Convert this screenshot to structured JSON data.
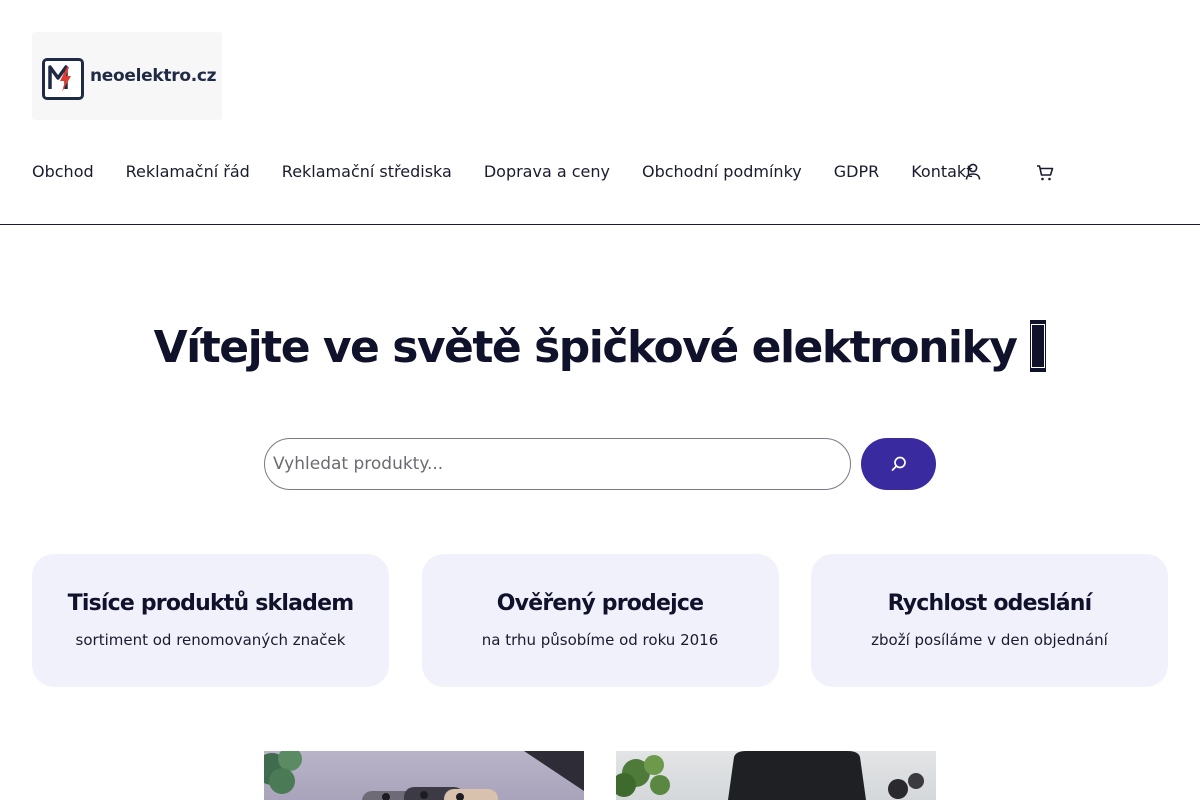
{
  "header": {
    "logo_text": "neoelektro.cz",
    "logo_mark_letter": "M",
    "nav": [
      {
        "label": "Obchod"
      },
      {
        "label": "Reklamační řád"
      },
      {
        "label": "Reklamační střediska"
      },
      {
        "label": "Doprava a ceny"
      },
      {
        "label": "Obchodní podmínky"
      },
      {
        "label": "GDPR"
      },
      {
        "label": "Kontakt"
      }
    ],
    "icons": {
      "account": "user-icon",
      "cart": "cart-icon"
    }
  },
  "hero": {
    "title": "Vítejte ve světě špičkové elektroniky",
    "title_glyph": "NO GLYPH"
  },
  "search": {
    "placeholder": "Vyhledat produkty...",
    "value": "",
    "button_icon": "search-icon"
  },
  "features": [
    {
      "title": "Tisíce produktů skladem",
      "text": "sortiment od renomovaných značek"
    },
    {
      "title": "Ověřený prodejce",
      "text": "na trhu působíme od roku 2016"
    },
    {
      "title": "Rychlost odeslání",
      "text": "zboží posíláme v den objednání"
    }
  ],
  "colors": {
    "accent": "#3a2aa0",
    "text": "#1a1b2e",
    "card_bg": "#f1f1fb",
    "logo_bolt": "#e03a2e"
  }
}
